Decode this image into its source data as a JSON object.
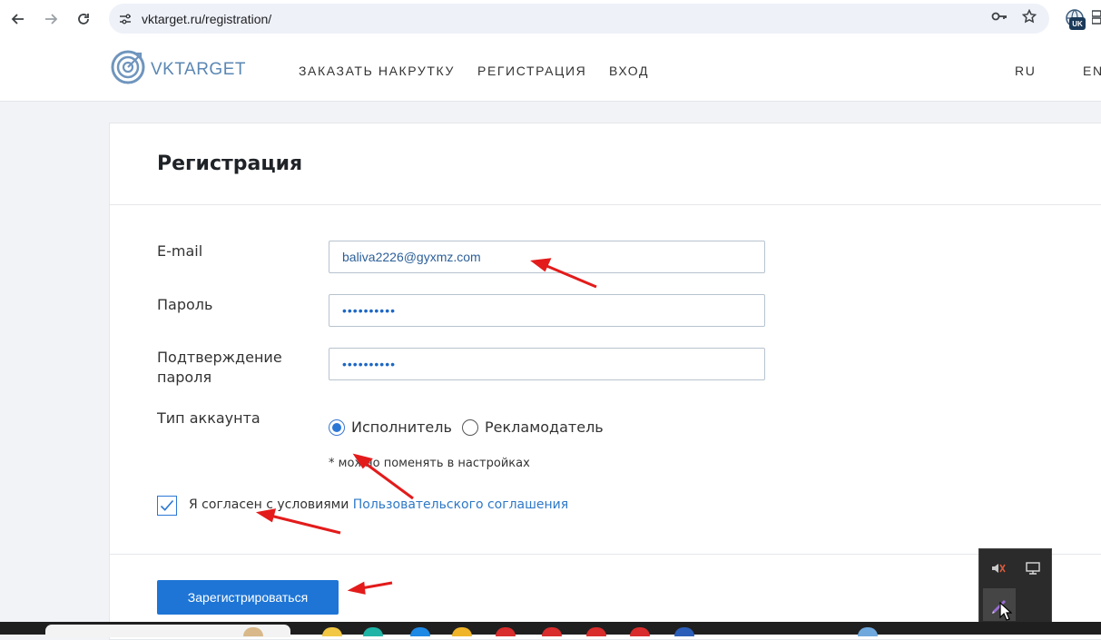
{
  "browser": {
    "url": "vktarget.ru/registration/",
    "extension_badge": "UK"
  },
  "header": {
    "logo_text": "VKTARGET",
    "nav": {
      "order": "ЗАКАЗАТЬ НАКРУТКУ",
      "register": "РЕГИСТРАЦИЯ",
      "login": "ВХОД"
    },
    "lang_ru": "RU",
    "lang_en": "EN"
  },
  "form": {
    "title": "Регистрация",
    "email": {
      "label": "E-mail",
      "value": "baliva2226@gyxmz.com"
    },
    "password": {
      "label": "Пароль",
      "value": "••••••••••"
    },
    "confirm": {
      "label": "Подтверждение пароля",
      "value": "••••••••••"
    },
    "account_type": {
      "label": "Тип аккаунта",
      "options": [
        {
          "label": "Исполнитель",
          "selected": true
        },
        {
          "label": "Рекламодатель",
          "selected": false
        }
      ],
      "hint": "* можно поменять в настройках"
    },
    "agree": {
      "checked": true,
      "text": "Я согласен с условиями",
      "link": "Пользовательского соглашения"
    },
    "submit_label": "Зарегистрироваться"
  },
  "colors": {
    "accent": "#1e75d5",
    "link": "#2e78c7",
    "annotation": "#e31b1b"
  }
}
